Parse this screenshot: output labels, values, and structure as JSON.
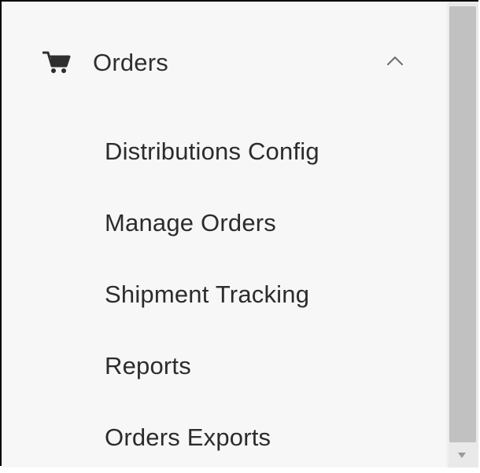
{
  "section": {
    "icon": "cart-icon",
    "label": "Orders",
    "expanded": true,
    "toggle_icon": "chevron-up-icon"
  },
  "menu": {
    "items": [
      {
        "label": "Distributions Config"
      },
      {
        "label": "Manage Orders"
      },
      {
        "label": "Shipment Tracking"
      },
      {
        "label": "Reports"
      },
      {
        "label": "Orders Exports"
      }
    ]
  },
  "colors": {
    "panel_background": "#f7f7f7",
    "text": "#2c2c2c",
    "scrollbar_thumb": "#c1c1c1",
    "scrollbar_track": "#e9e9e9"
  }
}
